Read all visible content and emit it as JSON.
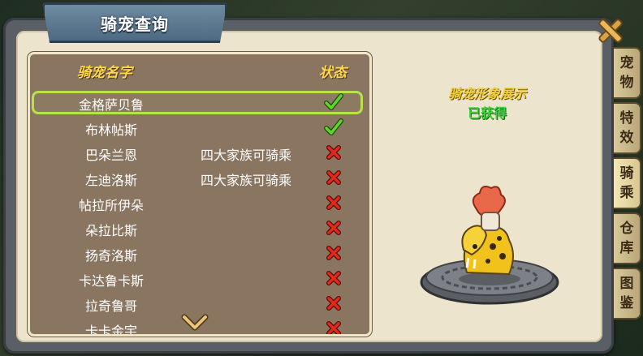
{
  "window": {
    "title": "骑宠查询"
  },
  "list": {
    "header_name": "骑宠名字",
    "header_status": "状态",
    "rows": [
      {
        "name": "金格萨贝鲁",
        "note": "",
        "status": "check",
        "selected": true
      },
      {
        "name": "布林帖斯",
        "note": "",
        "status": "check",
        "selected": false
      },
      {
        "name": "巴朵兰恩",
        "note": "四大家族可骑乘",
        "status": "cross",
        "selected": false
      },
      {
        "name": "左迪洛斯",
        "note": "四大家族可骑乘",
        "status": "cross",
        "selected": false
      },
      {
        "name": "帖拉所伊朵",
        "note": "",
        "status": "cross",
        "selected": false
      },
      {
        "name": "朵拉比斯",
        "note": "",
        "status": "cross",
        "selected": false
      },
      {
        "name": "扬奇洛斯",
        "note": "",
        "status": "cross",
        "selected": false
      },
      {
        "name": "卡达鲁卡斯",
        "note": "",
        "status": "cross",
        "selected": false
      },
      {
        "name": "拉奇鲁哥",
        "note": "",
        "status": "cross",
        "selected": false
      },
      {
        "name": "卡卡金宇",
        "note": "",
        "status": "cross",
        "selected": false
      }
    ]
  },
  "preview": {
    "title": "骑宠形象展示",
    "status": "已获得"
  },
  "tabs": [
    {
      "chars": [
        "宠",
        "物"
      ],
      "active": false
    },
    {
      "chars": [
        "特",
        "效"
      ],
      "active": false
    },
    {
      "chars": [
        "骑",
        "乘"
      ],
      "active": true
    },
    {
      "chars": [
        "仓",
        "库"
      ],
      "active": false
    },
    {
      "chars": [
        "图",
        "鉴"
      ],
      "active": false
    }
  ],
  "icons": {
    "check_color": "#5fd42a",
    "cross_color": "#e0281c",
    "close": "close-x-icon",
    "scroll_down": "chevron-down-icon"
  }
}
